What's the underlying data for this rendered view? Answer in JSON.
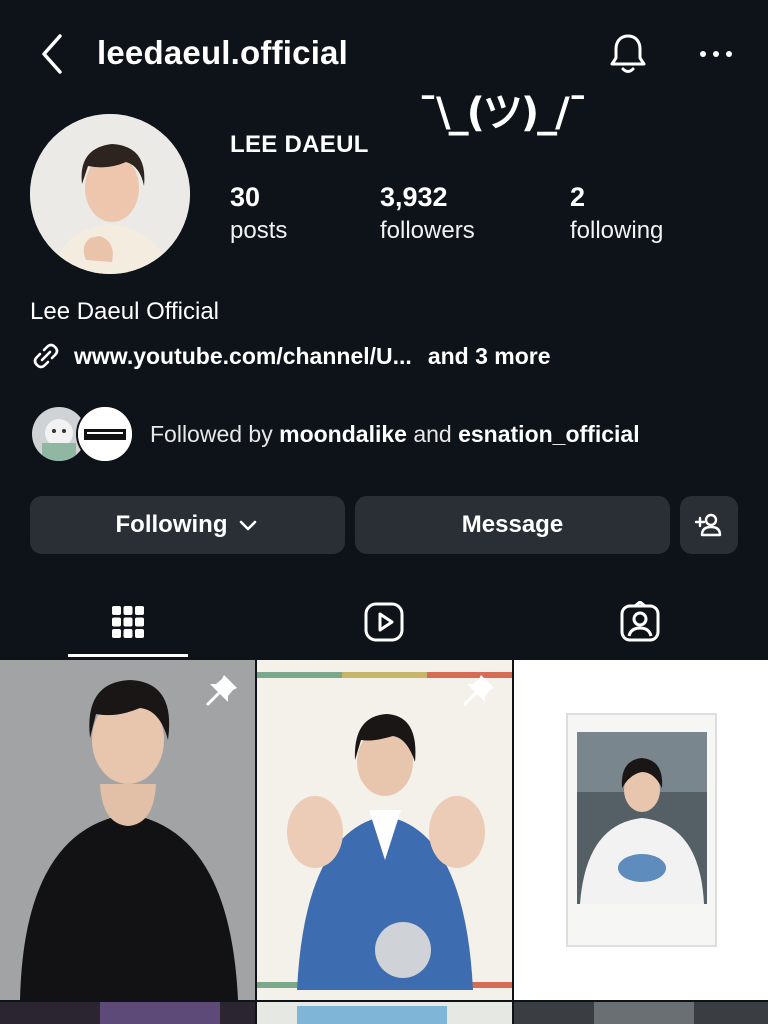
{
  "header": {
    "username": "leedaeul.official",
    "back_icon": "chevron-left-icon",
    "bell_icon": "bell-icon",
    "more_icon": "ellipsis-icon"
  },
  "overlay_text": "¯\\_(ツ)_/¯",
  "profile": {
    "display_name": "LEE DAEUL",
    "stats": [
      {
        "value": "30",
        "label": "posts"
      },
      {
        "value": "3,932",
        "label": "followers"
      },
      {
        "value": "2",
        "label": "following"
      }
    ],
    "bio_name": "Lee Daeul Official",
    "link_text": "www.youtube.com/channel/U...",
    "link_more": "and 3 more"
  },
  "followed_by": {
    "prefix": "Followed by",
    "user1": "moondalike",
    "conjunction": "and",
    "user2": "esnation_official"
  },
  "buttons": {
    "following": "Following",
    "message": "Message",
    "add_user_icon": "add-person-icon"
  },
  "tabs": [
    "grid-icon",
    "reels-icon",
    "tagged-icon"
  ],
  "grid_posts": [
    {
      "type": "photo",
      "pinned": true
    },
    {
      "type": "photo",
      "pinned": true
    },
    {
      "type": "carousel",
      "pinned": false
    },
    {
      "type": "photo",
      "pinned": false
    },
    {
      "type": "photo",
      "pinned": false
    },
    {
      "type": "photo",
      "pinned": false
    }
  ],
  "colors": {
    "background": "#0e131a",
    "button": "#2a2f36",
    "text": "#ffffff"
  }
}
